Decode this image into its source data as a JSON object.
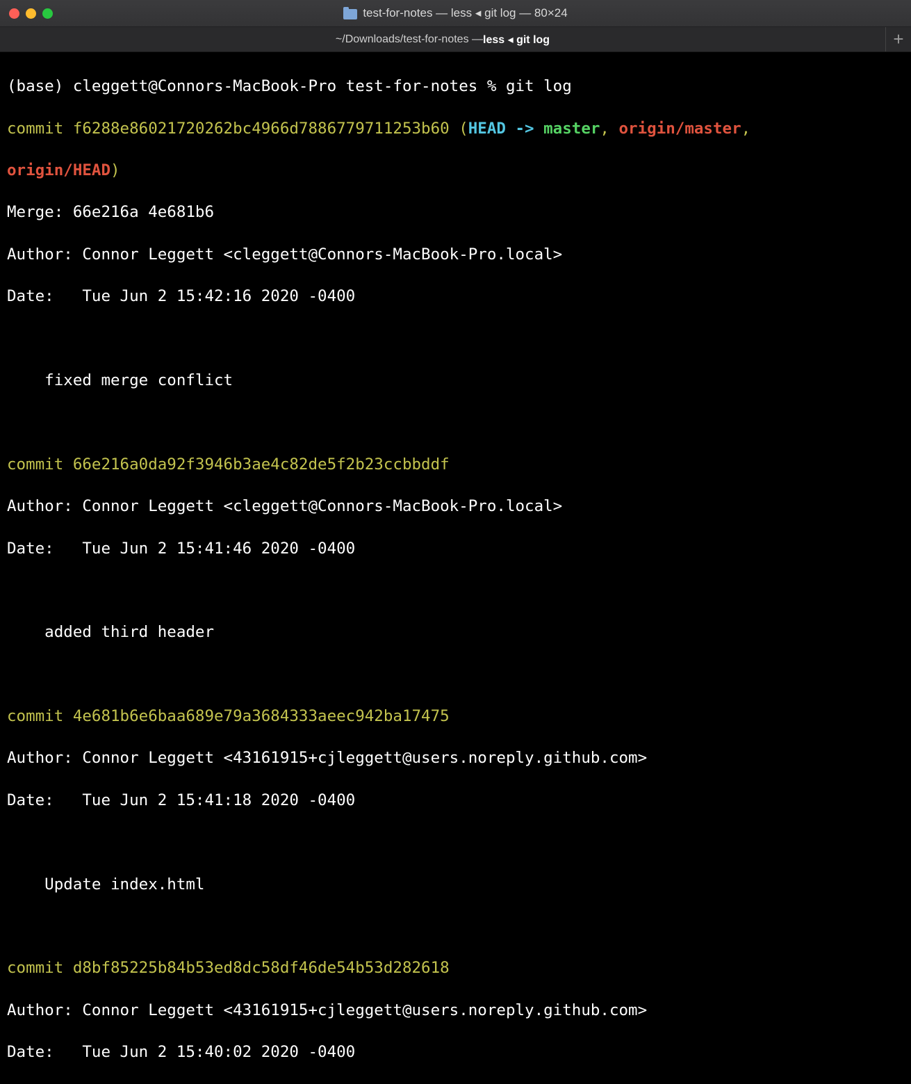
{
  "window": {
    "title": "test-for-notes — less ◂ git log — 80×24",
    "tab_path": "~/Downloads/test-for-notes — ",
    "tab_process": "less ◂ git log",
    "new_tab": "+"
  },
  "terminal": {
    "prompt": "(base) cleggett@Connors-MacBook-Pro test-for-notes % git log",
    "commits": [
      {
        "hash_line": "commit f6288e86021720262bc4966d7886779711253b60",
        "merge": "Merge: 66e216a 4e681b6",
        "author": "Author: Connor Leggett <cleggett@Connors-MacBook-Pro.local>",
        "date": "Date:   Tue Jun 2 15:42:16 2020 -0400",
        "message": "    fixed merge conflict"
      },
      {
        "hash_line": "commit 66e216a0da92f3946b3ae4c82de5f2b23ccbbddf",
        "author": "Author: Connor Leggett <cleggett@Connors-MacBook-Pro.local>",
        "date": "Date:   Tue Jun 2 15:41:46 2020 -0400",
        "message": "    added third header"
      },
      {
        "hash_line": "commit 4e681b6e6baa689e79a3684333aeec942ba17475",
        "author": "Author: Connor Leggett <43161915+cjleggett@users.noreply.github.com>",
        "date": "Date:   Tue Jun 2 15:41:18 2020 -0400",
        "message": "    Update index.html"
      },
      {
        "hash_line": "commit d8bf85225b84b53ed8dc58df46de54b53d282618",
        "author": "Author: Connor Leggett <43161915+cjleggett@users.noreply.github.com>",
        "date": "Date:   Tue Jun 2 15:40:02 2020 -0400"
      }
    ],
    "refs": {
      "open": " (",
      "head": "HEAD -> ",
      "master": "master",
      "sep1": ", ",
      "origin_master": "origin/master",
      "sep2": ",",
      "origin_head": "origin/HEAD",
      "close": ")"
    }
  },
  "colors": {
    "background": "#000000",
    "commit_yellow": "#c3c34e",
    "head_cyan": "#53c6e2",
    "branch_green": "#56d364",
    "remote_red": "#e0533e"
  }
}
